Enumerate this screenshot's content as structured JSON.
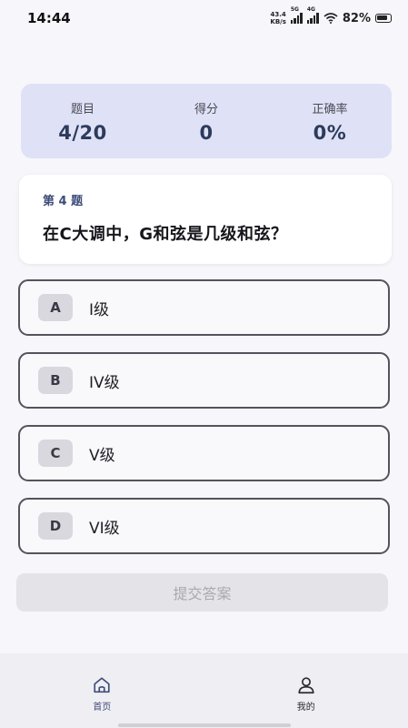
{
  "status_bar": {
    "time": "14:44",
    "net_speed_top": "43.4",
    "net_speed_bottom": "KB/s",
    "sim1_label": "5G",
    "sim2_label": "4G",
    "battery": "82%"
  },
  "stats": {
    "question_label": "题目",
    "question_value": "4/20",
    "score_label": "得分",
    "score_value": "0",
    "accuracy_label": "正确率",
    "accuracy_value": "0%"
  },
  "question": {
    "number": "第 4 题",
    "text": "在C大调中，G和弦是几级和弦？"
  },
  "options": [
    {
      "letter": "A",
      "text": "I级"
    },
    {
      "letter": "B",
      "text": "IV级"
    },
    {
      "letter": "C",
      "text": "V级"
    },
    {
      "letter": "D",
      "text": "VI级"
    }
  ],
  "submit_label": "提交答案",
  "nav": {
    "home": {
      "label": "首页",
      "icon": "home-icon"
    },
    "profile": {
      "label": "我的",
      "icon": "user-icon"
    }
  },
  "colors": {
    "accent": "#3f4d78",
    "stats_bg": "#dfe2f6"
  }
}
